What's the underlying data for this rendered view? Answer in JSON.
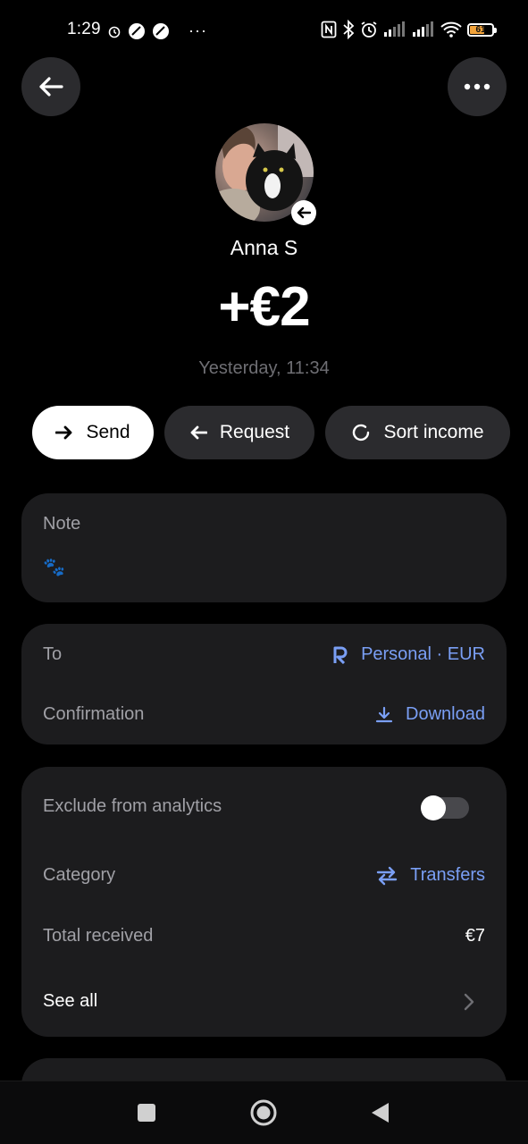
{
  "status_bar": {
    "time": "1:29",
    "more_indicator": "···",
    "battery_level": "61",
    "icons": [
      "alarm-icon",
      "app-notification-icon",
      "app-notification-icon",
      "nfc-icon",
      "bluetooth-icon",
      "alarm-icon",
      "signal-icon",
      "signal-icon",
      "wifi-icon",
      "battery-icon"
    ]
  },
  "header": {
    "back_icon": "arrow-left-icon",
    "more_icon": "more-horizontal-icon"
  },
  "transaction": {
    "contact_name": "Anna S",
    "amount": "+€2",
    "date": "Yesterday, 11:34",
    "direction_icon": "arrow-left-icon"
  },
  "actions": {
    "send_label": "Send",
    "request_label": "Request",
    "sort_label": "Sort income"
  },
  "note": {
    "label": "Note",
    "value": "🐾"
  },
  "details": {
    "to_label": "To",
    "to_value": "Personal · EUR",
    "to_icon": "revolut-r-icon",
    "confirmation_label": "Confirmation",
    "confirmation_value": "Download",
    "confirmation_icon": "download-icon"
  },
  "analytics": {
    "exclude_label": "Exclude from analytics",
    "exclude_enabled": false,
    "category_label": "Category",
    "category_value": "Transfers",
    "category_icon": "transfer-arrows-icon",
    "total_label": "Total received",
    "total_value": "€7",
    "see_all_label": "See all"
  },
  "colors": {
    "background": "#000000",
    "card": "#1c1c1e",
    "pill": "#2b2b2e",
    "accent": "#7a9ff5",
    "muted": "#a0a0a6"
  }
}
